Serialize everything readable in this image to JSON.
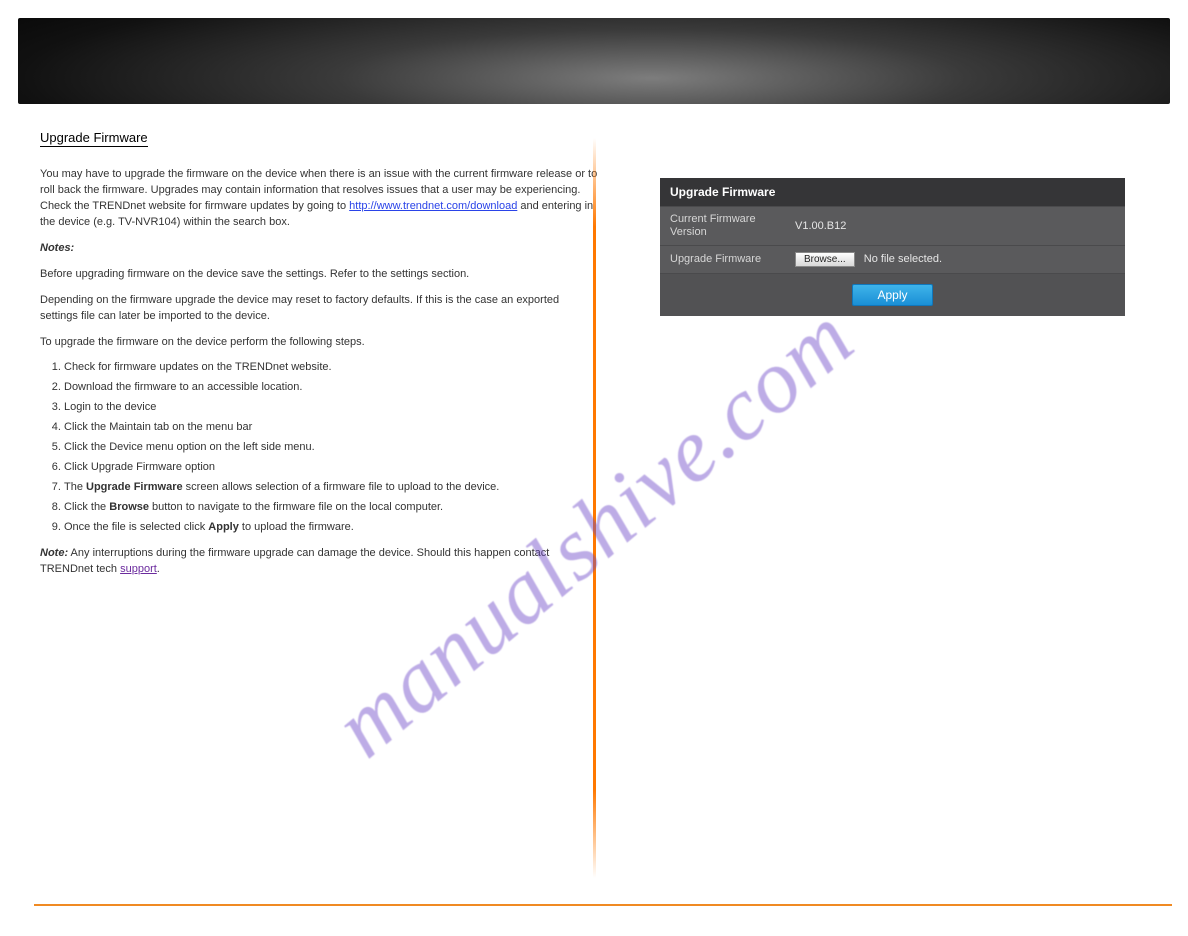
{
  "section_title": "Upgrade Firmware",
  "intro": {
    "p1a": "You may have to upgrade the firmware on the device when there is an issue with the current firmware release or to roll back the firmware. Upgrades may contain information that resolves issues that a user may be experiencing. Check the TRENDnet website for firmware updates by going to ",
    "link_text": "http://www.trendnet.com/download",
    "p1b": " and entering in the device (e.g. TV-NVR104) within the search box."
  },
  "notes_label": "Notes:",
  "notes": {
    "n1": "Before upgrading firmware on the device save the settings. Refer to the settings section.",
    "n2": "Depending on the firmware upgrade the device may reset to factory defaults. If this is the case an exported settings file can later be imported to the device."
  },
  "instructions_intro": "To upgrade the firmware on the device perform the following steps.",
  "steps": [
    "Check for firmware updates on the TRENDnet website.",
    "Download the firmware to an accessible location.",
    "Login to the device",
    "Click the Maintain tab on the menu bar",
    "Click the Device menu option on the left side menu.",
    "Click Upgrade Firmware option",
    "The Upgrade Firmware screen allows selection of a firmware file to upload to the device.",
    "Click the Browse button to navigate to the firmware file on the local computer.",
    "Once the file is selected click Apply to upload the firmware."
  ],
  "step7_prefix": "The ",
  "step7_bold": "Upgrade Firmware",
  "step7_suffix": " screen allows selection of a firmware file to upload to the device.",
  "step8_prefix": "Click the ",
  "step8_bold": "Browse",
  "step8_suffix": " button to navigate to the firmware file on the local computer.",
  "step9_prefix": "Once the file is selected click ",
  "step9_bold": "Apply",
  "step9_suffix": " to upload the firmware.",
  "tech_note": {
    "label": "Note:",
    "prefix": " Any interruptions during the firmware upgrade can damage the device. Should this happen contact TRENDnet tech ",
    "link": "support",
    "suffix": "."
  },
  "panel": {
    "title": "Upgrade Firmware",
    "row1_label": "Current Firmware Version",
    "row1_value": "V1.00.B12",
    "row2_label": "Upgrade Firmware",
    "browse": "Browse...",
    "nofile": "No file selected.",
    "apply": "Apply"
  },
  "watermark": "manualshive.com"
}
